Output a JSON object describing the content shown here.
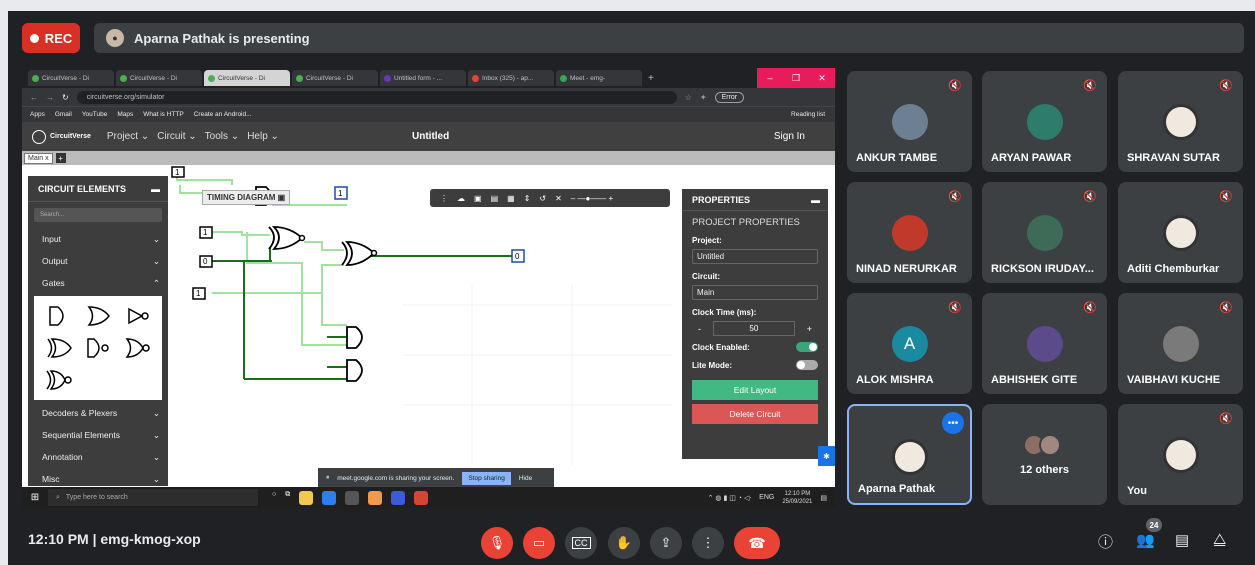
{
  "top": {
    "rec_label": "REC",
    "presenting": "Aparna Pathak is presenting"
  },
  "browser": {
    "tabs": [
      "CircuitVerse - Di",
      "CircuitVerse - Di",
      "CircuitVerse - Di",
      "CircuitVerse - Di",
      "Untitled form - ...",
      "Inbox (325) - ap...",
      "Meet - emg-"
    ],
    "active_tab": 2,
    "url": "circuitverse.org/simulator",
    "error_chip": "Error",
    "bookmarks": [
      "Apps",
      "Gmail",
      "YouTube",
      "Maps",
      "What is HTTP",
      "Create an Android..."
    ],
    "reading_list": "Reading list"
  },
  "circuitverse": {
    "logo": "CircuitVerse",
    "menus": [
      "Project",
      "Circuit",
      "Tools",
      "Help"
    ],
    "title": "Untitled",
    "sign_in": "Sign In",
    "tab": "Main"
  },
  "elements_panel": {
    "header": "CIRCUIT ELEMENTS",
    "search_placeholder": "Search...",
    "groups_top": [
      "Input",
      "Output",
      "Gates"
    ],
    "groups_bottom": [
      "Decoders & Plexers",
      "Sequential Elements",
      "Annotation",
      "Misc"
    ]
  },
  "timing_diagram": "TIMING DIAGRAM",
  "properties": {
    "header": "PROPERTIES",
    "subheader": "PROJECT PROPERTIES",
    "project_label": "Project:",
    "project_value": "Untitled",
    "circuit_label": "Circuit:",
    "circuit_value": "Main",
    "clock_label": "Clock Time (ms):",
    "clock_value": "50",
    "clock_enabled_label": "Clock Enabled:",
    "clock_enabled": true,
    "lite_mode_label": "Lite Mode:",
    "lite_mode": false,
    "edit_layout": "Edit Layout",
    "delete_circuit": "Delete Circuit"
  },
  "share_bar": {
    "text": "meet.google.com is sharing your screen.",
    "stop": "Stop sharing",
    "hide": "Hide"
  },
  "taskbar": {
    "search_placeholder": "Type here to search",
    "lang": "ENG",
    "time": "12:10 PM",
    "date": "25/09/2021"
  },
  "participants": [
    {
      "name": "ANKUR TAMBE",
      "muted": true
    },
    {
      "name": "ARYAN PAWAR",
      "muted": true
    },
    {
      "name": "SHRAVAN SUTAR",
      "muted": true
    },
    {
      "name": "NINAD NERURKAR",
      "muted": true
    },
    {
      "name": "RICKSON IRUDAY...",
      "muted": true
    },
    {
      "name": "Aditi Chemburkar",
      "muted": true
    },
    {
      "name": "ALOK MISHRA",
      "muted": true,
      "initial": "A"
    },
    {
      "name": "ABHISHEK GITE",
      "muted": true
    },
    {
      "name": "VAIBHAVI KUCHE",
      "muted": true
    },
    {
      "name": "Aparna Pathak",
      "muted": false
    },
    {
      "name": "12 others",
      "muted": false
    },
    {
      "name": "You",
      "muted": true
    }
  ],
  "bottom": {
    "time_code": "12:10 PM  |  emg-kmog-xop",
    "people_count": "24"
  },
  "colors": {
    "rec_red": "#d93025",
    "meet_bg": "#202124",
    "tile_bg": "#3c4043",
    "active_border": "#8ab4f8",
    "hangup_red": "#ea4335",
    "edit_green": "#42b983",
    "delete_red": "#dc5656",
    "wire_dark": "#1b6e1b",
    "wire_light": "#9fe39f"
  }
}
